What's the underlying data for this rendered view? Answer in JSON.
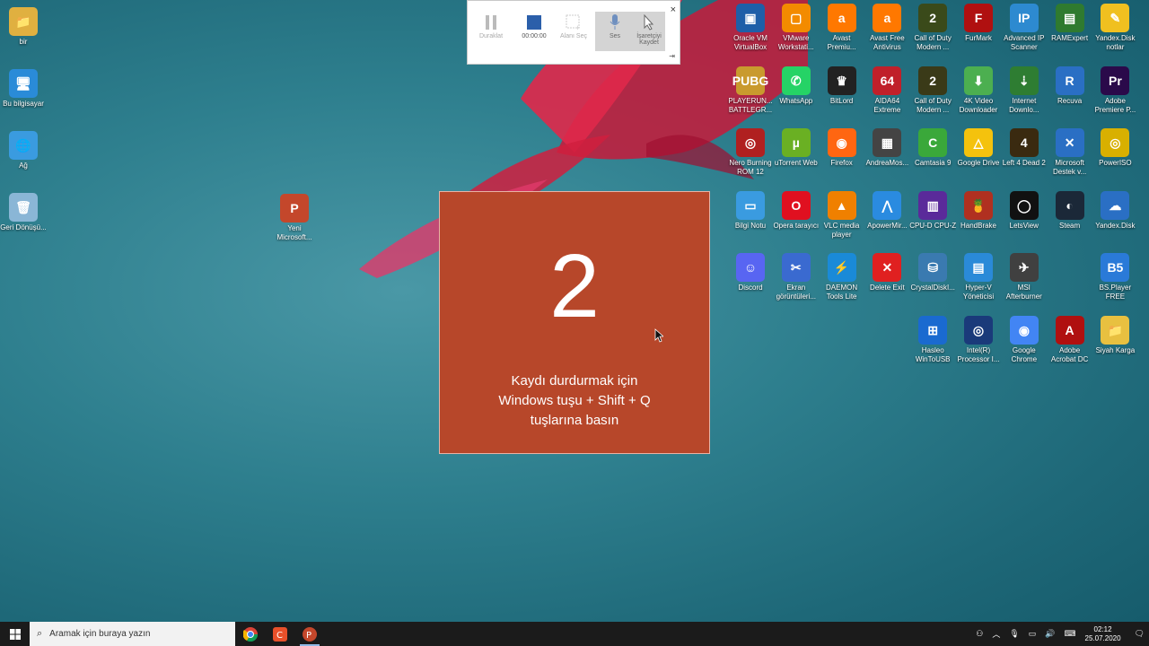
{
  "recorder": {
    "pause": "Duraklat",
    "timer": "00:00:00",
    "select_area": "Alanı Seç",
    "audio": "Ses",
    "record_pointer": "İşaretçiyi Kaydet",
    "close": "×",
    "pin": "⇥"
  },
  "countdown": {
    "number": "2",
    "line1": "Kaydı durdurmak için",
    "line2": "Windows  tuşu + Shift + Q",
    "line3": "tuşlarına basın"
  },
  "desktop_left": [
    {
      "label": "bir",
      "color": "#e0b040",
      "glyph": "📁"
    },
    {
      "label": "Bu bilgisayar",
      "color": "#2a8bd8",
      "glyph": "🖥"
    },
    {
      "label": "Ağ",
      "color": "#3a9be0",
      "glyph": "🌐"
    },
    {
      "label": "Geri Dönüşü...",
      "color": "#8ab6d6",
      "glyph": "🗑"
    }
  ],
  "desktop_mid": {
    "label": "Yeni Microsoft...",
    "color": "#c4472b",
    "glyph": "P"
  },
  "desktop_grid": [
    [
      {
        "label": "Oracle VM VirtualBox",
        "color": "#1e5fa8",
        "glyph": "▣"
      },
      {
        "label": "VMware Workstati...",
        "color": "#f38b00",
        "glyph": "▢"
      },
      {
        "label": "Avast Premiu...",
        "color": "#ff7800",
        "glyph": "a"
      },
      {
        "label": "Avast Free Antivirus",
        "color": "#ff7800",
        "glyph": "a"
      },
      {
        "label": "Call of Duty Modern ...",
        "color": "#3a4a1a",
        "glyph": "2"
      },
      {
        "label": "FurMark",
        "color": "#b01010",
        "glyph": "F"
      },
      {
        "label": "Advanced IP Scanner",
        "color": "#2d8ad0",
        "glyph": "IP"
      },
      {
        "label": "RAMExpert",
        "color": "#2f7a2f",
        "glyph": "▤"
      },
      {
        "label": "Yandex.Disk notlar",
        "color": "#f0c020",
        "glyph": "✎"
      }
    ],
    [
      {
        "label": "PLAYERUN... BATTLEGR...",
        "color": "#c99a2e",
        "glyph": "PUBG"
      },
      {
        "label": "WhatsApp",
        "color": "#25d366",
        "glyph": "✆"
      },
      {
        "label": "BitLord",
        "color": "#222",
        "glyph": "♛"
      },
      {
        "label": "AIDA64 Extreme",
        "color": "#c0202a",
        "glyph": "64"
      },
      {
        "label": "Call of Duty Modern ...",
        "color": "#3a3a18",
        "glyph": "2"
      },
      {
        "label": "4K Video Downloader",
        "color": "#4caf50",
        "glyph": "⬇"
      },
      {
        "label": "Internet Downlo...",
        "color": "#2e7d32",
        "glyph": "⇣"
      },
      {
        "label": "Recuva",
        "color": "#2a6fc4",
        "glyph": "R"
      },
      {
        "label": "Adobe Premiere P...",
        "color": "#2a0a4a",
        "glyph": "Pr"
      }
    ],
    [
      {
        "label": "Nero Burning ROM 12",
        "color": "#b02020",
        "glyph": "◎"
      },
      {
        "label": "uTorrent Web",
        "color": "#6ab023",
        "glyph": "µ"
      },
      {
        "label": "Firefox",
        "color": "#ff6611",
        "glyph": "◉"
      },
      {
        "label": "AndreaMos...",
        "color": "#444",
        "glyph": "▦"
      },
      {
        "label": "Camtasia 9",
        "color": "#3aa83a",
        "glyph": "C"
      },
      {
        "label": "Google Drive",
        "color": "#f4c20d",
        "glyph": "△"
      },
      {
        "label": "Left 4 Dead 2",
        "color": "#3a2a10",
        "glyph": "4"
      },
      {
        "label": "Microsoft Destek v...",
        "color": "#2a6fc4",
        "glyph": "✕"
      },
      {
        "label": "PowerISO",
        "color": "#d8b000",
        "glyph": "◎"
      }
    ],
    [
      {
        "label": "Bilgi Notu",
        "color": "#3a9be0",
        "glyph": "▭"
      },
      {
        "label": "Opera tarayıcı",
        "color": "#e01020",
        "glyph": "O"
      },
      {
        "label": "VLC media player",
        "color": "#f08000",
        "glyph": "▲"
      },
      {
        "label": "ApowerMir...",
        "color": "#2a8be0",
        "glyph": "⋀"
      },
      {
        "label": "CPU-D CPU-Z",
        "color": "#5a2a9a",
        "glyph": "▥"
      },
      {
        "label": "HandBrake",
        "color": "#b03020",
        "glyph": "🍍"
      },
      {
        "label": "LetsView",
        "color": "#111",
        "glyph": "◯"
      },
      {
        "label": "Steam",
        "color": "#1b2838",
        "glyph": "◐"
      },
      {
        "label": "Yandex.Disk",
        "color": "#2a6fc4",
        "glyph": "☁"
      }
    ],
    [
      {
        "label": "Discord",
        "color": "#5865f2",
        "glyph": "☺"
      },
      {
        "label": "Ekran görüntüleri...",
        "color": "#3a6ad0",
        "glyph": "✂"
      },
      {
        "label": "DAEMON Tools Lite",
        "color": "#1a8ad8",
        "glyph": "⚡"
      },
      {
        "label": "Delete Exit",
        "color": "#e02020",
        "glyph": "✕"
      },
      {
        "label": "CrystalDiskI...",
        "color": "#3a7ab0",
        "glyph": "⛁"
      },
      {
        "label": "Hyper-V Yöneticisi",
        "color": "#2a8ad8",
        "glyph": "▤"
      },
      {
        "label": "MSI Afterburner",
        "color": "#404040",
        "glyph": "✈"
      },
      {
        "label": "",
        "color": "transparent",
        "glyph": ""
      },
      {
        "label": "BS.Player FREE",
        "color": "#2a7ad8",
        "glyph": "B5"
      }
    ],
    [
      {
        "label": "",
        "color": "transparent",
        "glyph": ""
      },
      {
        "label": "",
        "color": "transparent",
        "glyph": ""
      },
      {
        "label": "",
        "color": "transparent",
        "glyph": ""
      },
      {
        "label": "",
        "color": "transparent",
        "glyph": ""
      },
      {
        "label": "Hasleo WinToUSB",
        "color": "#1a6ad0",
        "glyph": "⊞"
      },
      {
        "label": "Intel(R) Processor I...",
        "color": "#1a3a7a",
        "glyph": "◎"
      },
      {
        "label": "Google Chrome",
        "color": "#4285f4",
        "glyph": "◉"
      },
      {
        "label": "Adobe Acrobat DC",
        "color": "#b01010",
        "glyph": "A"
      },
      {
        "label": "Siyah Karga",
        "color": "#e8c040",
        "glyph": "📁"
      }
    ]
  ],
  "taskbar": {
    "search_placeholder": "Aramak için buraya yazın",
    "time": "02:12",
    "date": "25.07.2020"
  }
}
